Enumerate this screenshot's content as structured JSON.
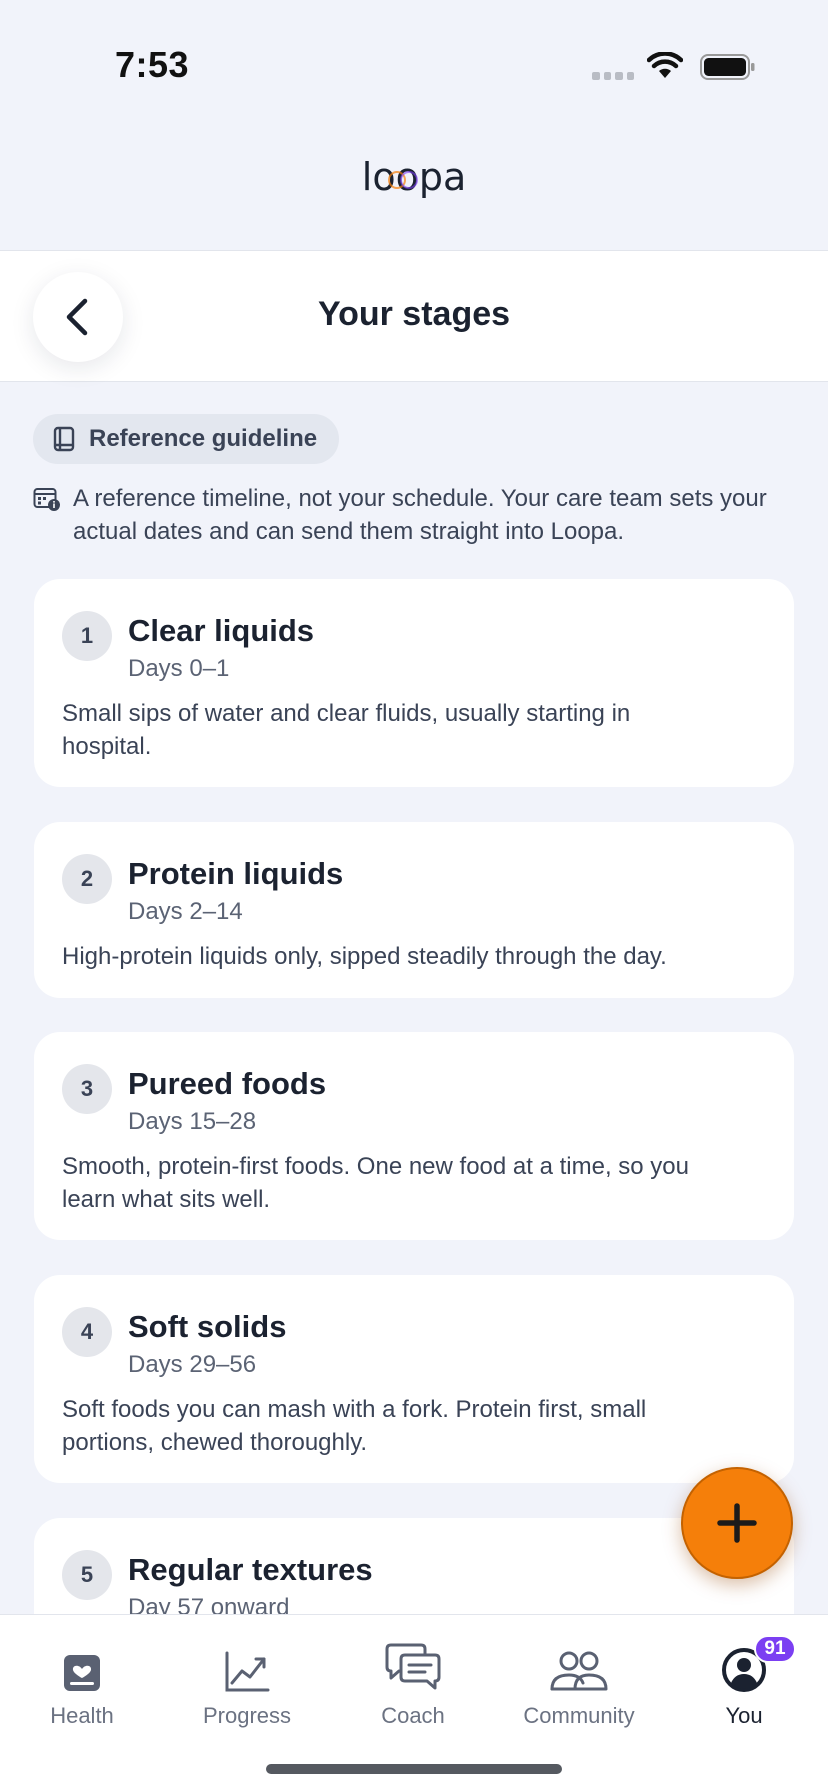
{
  "status_bar": {
    "time": "7:53"
  },
  "brand": {
    "logo_text": "loopa"
  },
  "header": {
    "title": "Your stages"
  },
  "guideline": {
    "chip_label": "Reference guideline",
    "note": "A reference timeline, not your schedule. Your care team sets your actual dates and can send them straight into Loopa."
  },
  "stages": [
    {
      "number": "1",
      "title": "Clear liquids",
      "days": "Days 0–1",
      "description": "Small sips of water and clear fluids, usually starting in hospital."
    },
    {
      "number": "2",
      "title": "Protein liquids",
      "days": "Days 2–14",
      "description": "High-protein liquids only, sipped steadily through the day."
    },
    {
      "number": "3",
      "title": "Pureed foods",
      "days": "Days 15–28",
      "description": "Smooth, protein-first foods. One new food at a time, so you learn what sits well."
    },
    {
      "number": "4",
      "title": "Soft solids",
      "days": "Days 29–56",
      "description": "Soft foods you can mash with a fork. Protein first, small portions, chewed thoroughly."
    },
    {
      "number": "5",
      "title": "Regular textures",
      "days": "Day 57 onward",
      "description": ""
    }
  ],
  "tabs": [
    {
      "label": "Health",
      "icon": "health-icon"
    },
    {
      "label": "Progress",
      "icon": "progress-chart-icon"
    },
    {
      "label": "Coach",
      "icon": "chat-bubbles-icon"
    },
    {
      "label": "Community",
      "icon": "people-icon"
    },
    {
      "label": "You",
      "icon": "profile-icon",
      "badge": "91",
      "active": true
    }
  ],
  "colors": {
    "accent": "#f57f0a",
    "badge": "#7b3ff2",
    "background": "#f1f3fa"
  }
}
